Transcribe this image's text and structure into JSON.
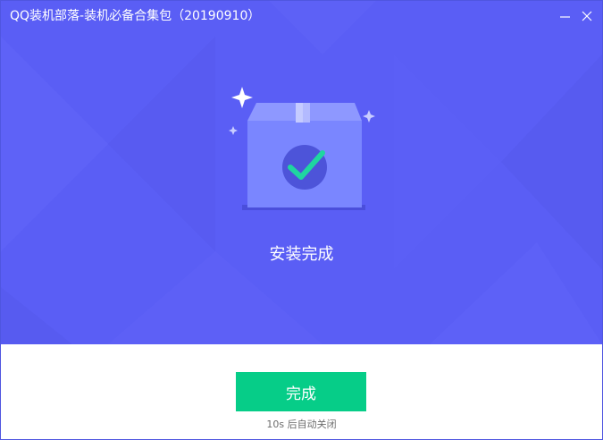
{
  "window": {
    "title": "QQ装机部落-装机必备合集包（20190910）"
  },
  "status": {
    "message": "安装完成"
  },
  "actions": {
    "finish_label": "完成",
    "countdown": "10s 后自动关闭"
  },
  "icons": {
    "minimize": "minimize-icon",
    "close": "close-icon",
    "illustration": "package-check-icon",
    "sparkles": "sparkle-icon"
  },
  "colors": {
    "hero_background": "#5a5ef5",
    "finish_button": "#06cd88",
    "check": "#1fd6a0",
    "box": "#7a86ff"
  }
}
